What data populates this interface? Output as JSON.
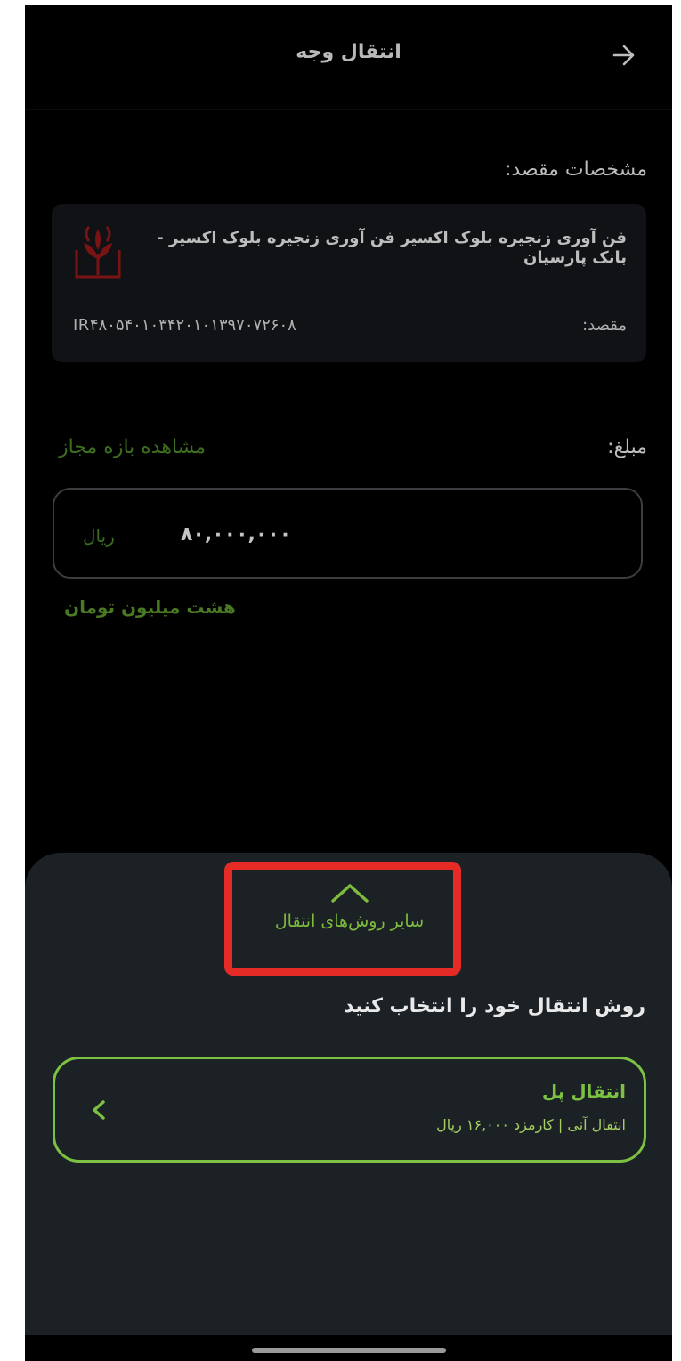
{
  "header": {
    "title": "انتقال وجه",
    "back_icon": "arrow-right-icon"
  },
  "destination": {
    "section_label": "مشخصات مقصد:",
    "name": "فن آوری زنجیره بلوک اکسیر فن آوری زنجیره بلوک اکسیر - بانک پارسیان",
    "dest_label": "مقصد:",
    "iban": "IR۴۸۰۵۴۰۱۰۳۴۲۰۱۰۱۳۹۷۰۷۲۶۰۸",
    "bank_logo_icon": "parsian-bank-logo"
  },
  "amount": {
    "label": "مبلغ:",
    "range_link": "مشاهده بازه مجاز",
    "currency": "ریال",
    "value": "۸۰,۰۰۰,۰۰۰",
    "in_words": "هشت میلیون تومان"
  },
  "sheet": {
    "other_methods_label": "سایر روش‌های انتقال",
    "other_methods_icon": "chevron-up-icon",
    "choose_label": "روش انتقال خود را انتخاب کنید",
    "methods": [
      {
        "title": "انتقال پل",
        "subtitle": "انتقال آنی | کارمزد ۱۶,۰۰۰ ریال",
        "icon": "chevron-left-icon"
      }
    ]
  },
  "colors": {
    "accent": "#7cc142",
    "highlight": "#e42b25",
    "sheet_bg": "#1c2126"
  }
}
